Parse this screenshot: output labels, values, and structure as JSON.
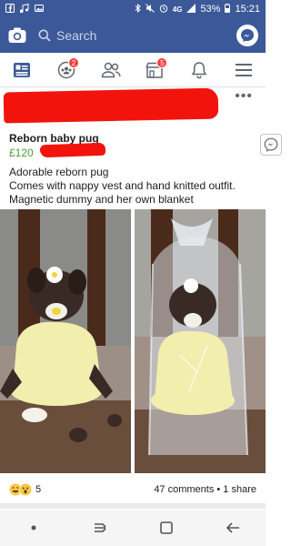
{
  "status_bar": {
    "battery": "53%",
    "time": "15:21",
    "network": "4G"
  },
  "search": {
    "placeholder": "Search"
  },
  "nav": {
    "groups_badge": "2",
    "marketplace_badge": "5"
  },
  "listing": {
    "title": "Reborn baby pug",
    "price": "£120",
    "description_lines": [
      "Adorable reborn pug",
      "Comes with nappy vest and hand knitted outfit.",
      "Magnetic dummy and her own blanket"
    ]
  },
  "footer": {
    "reaction_count": "5",
    "stats": "47 comments • 1 share"
  },
  "colors": {
    "facebook_blue": "#3b5998",
    "price_green": "#4a9e3a",
    "redaction_red": "#f2140c",
    "badge_red": "#fa3e3e"
  },
  "icons": {
    "status_left": [
      "facebook-icon",
      "music-icon",
      "gallery-icon"
    ],
    "status_right": [
      "bluetooth-icon",
      "mute-icon",
      "alarm-icon",
      "wifi-icon",
      "signal-icon",
      "battery-icon"
    ],
    "nav": [
      "news-feed-icon",
      "groups-icon",
      "friends-icon",
      "marketplace-icon",
      "notifications-icon",
      "menu-icon"
    ],
    "android": [
      "home-dot-icon",
      "recents-icon",
      "overview-icon",
      "back-icon"
    ]
  }
}
